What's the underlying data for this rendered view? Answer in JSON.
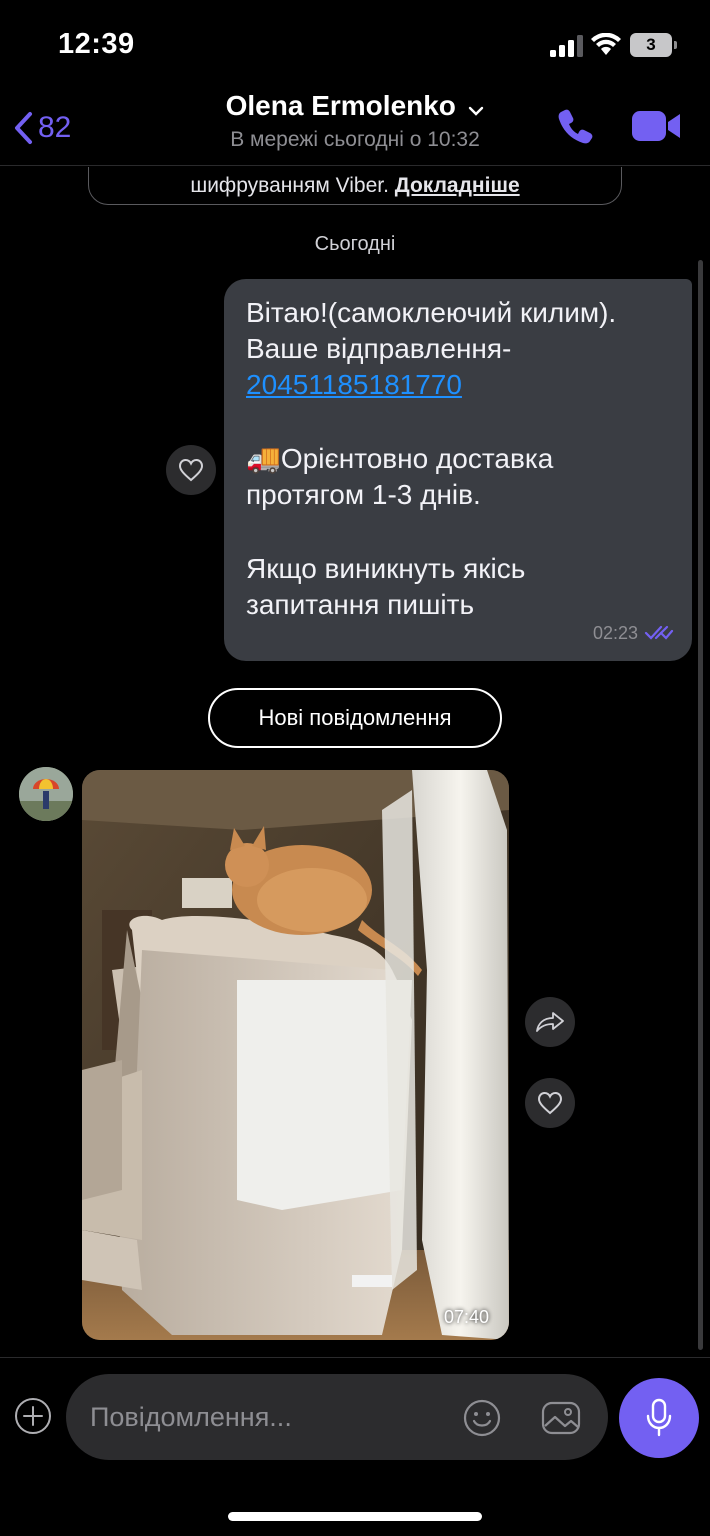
{
  "status_bar": {
    "time": "12:39",
    "battery": "3"
  },
  "header": {
    "back_count": "82",
    "contact_name": "Olena Ermolenko",
    "presence": "В мережі сьогодні о 10:32"
  },
  "chat": {
    "system_note": {
      "text": "шифруванням Viber.",
      "link": "Докладніше"
    },
    "date_separator": "Сьогодні",
    "outgoing_message": {
      "line1": "Вітаю!(самоклеючий килим).",
      "line2": "Ваше відправлення-",
      "tracking": "20451185181770",
      "emoji": "🚚",
      "line3": "Орієнтовно доставка",
      "line4": "протягом 1-3 днів.",
      "line5": "Якщо виникнуть якісь",
      "line6": "запитання пишіть",
      "time": "02:23",
      "status_icon": "double-check-icon"
    },
    "new_messages_label": "Нові повідомлення",
    "incoming_photo": {
      "time": "07:40"
    }
  },
  "composer": {
    "placeholder": "Повідомлення..."
  },
  "colors": {
    "accent": "#7360f2",
    "bubble_out": "#3a3d43",
    "link": "#1e90ff"
  }
}
